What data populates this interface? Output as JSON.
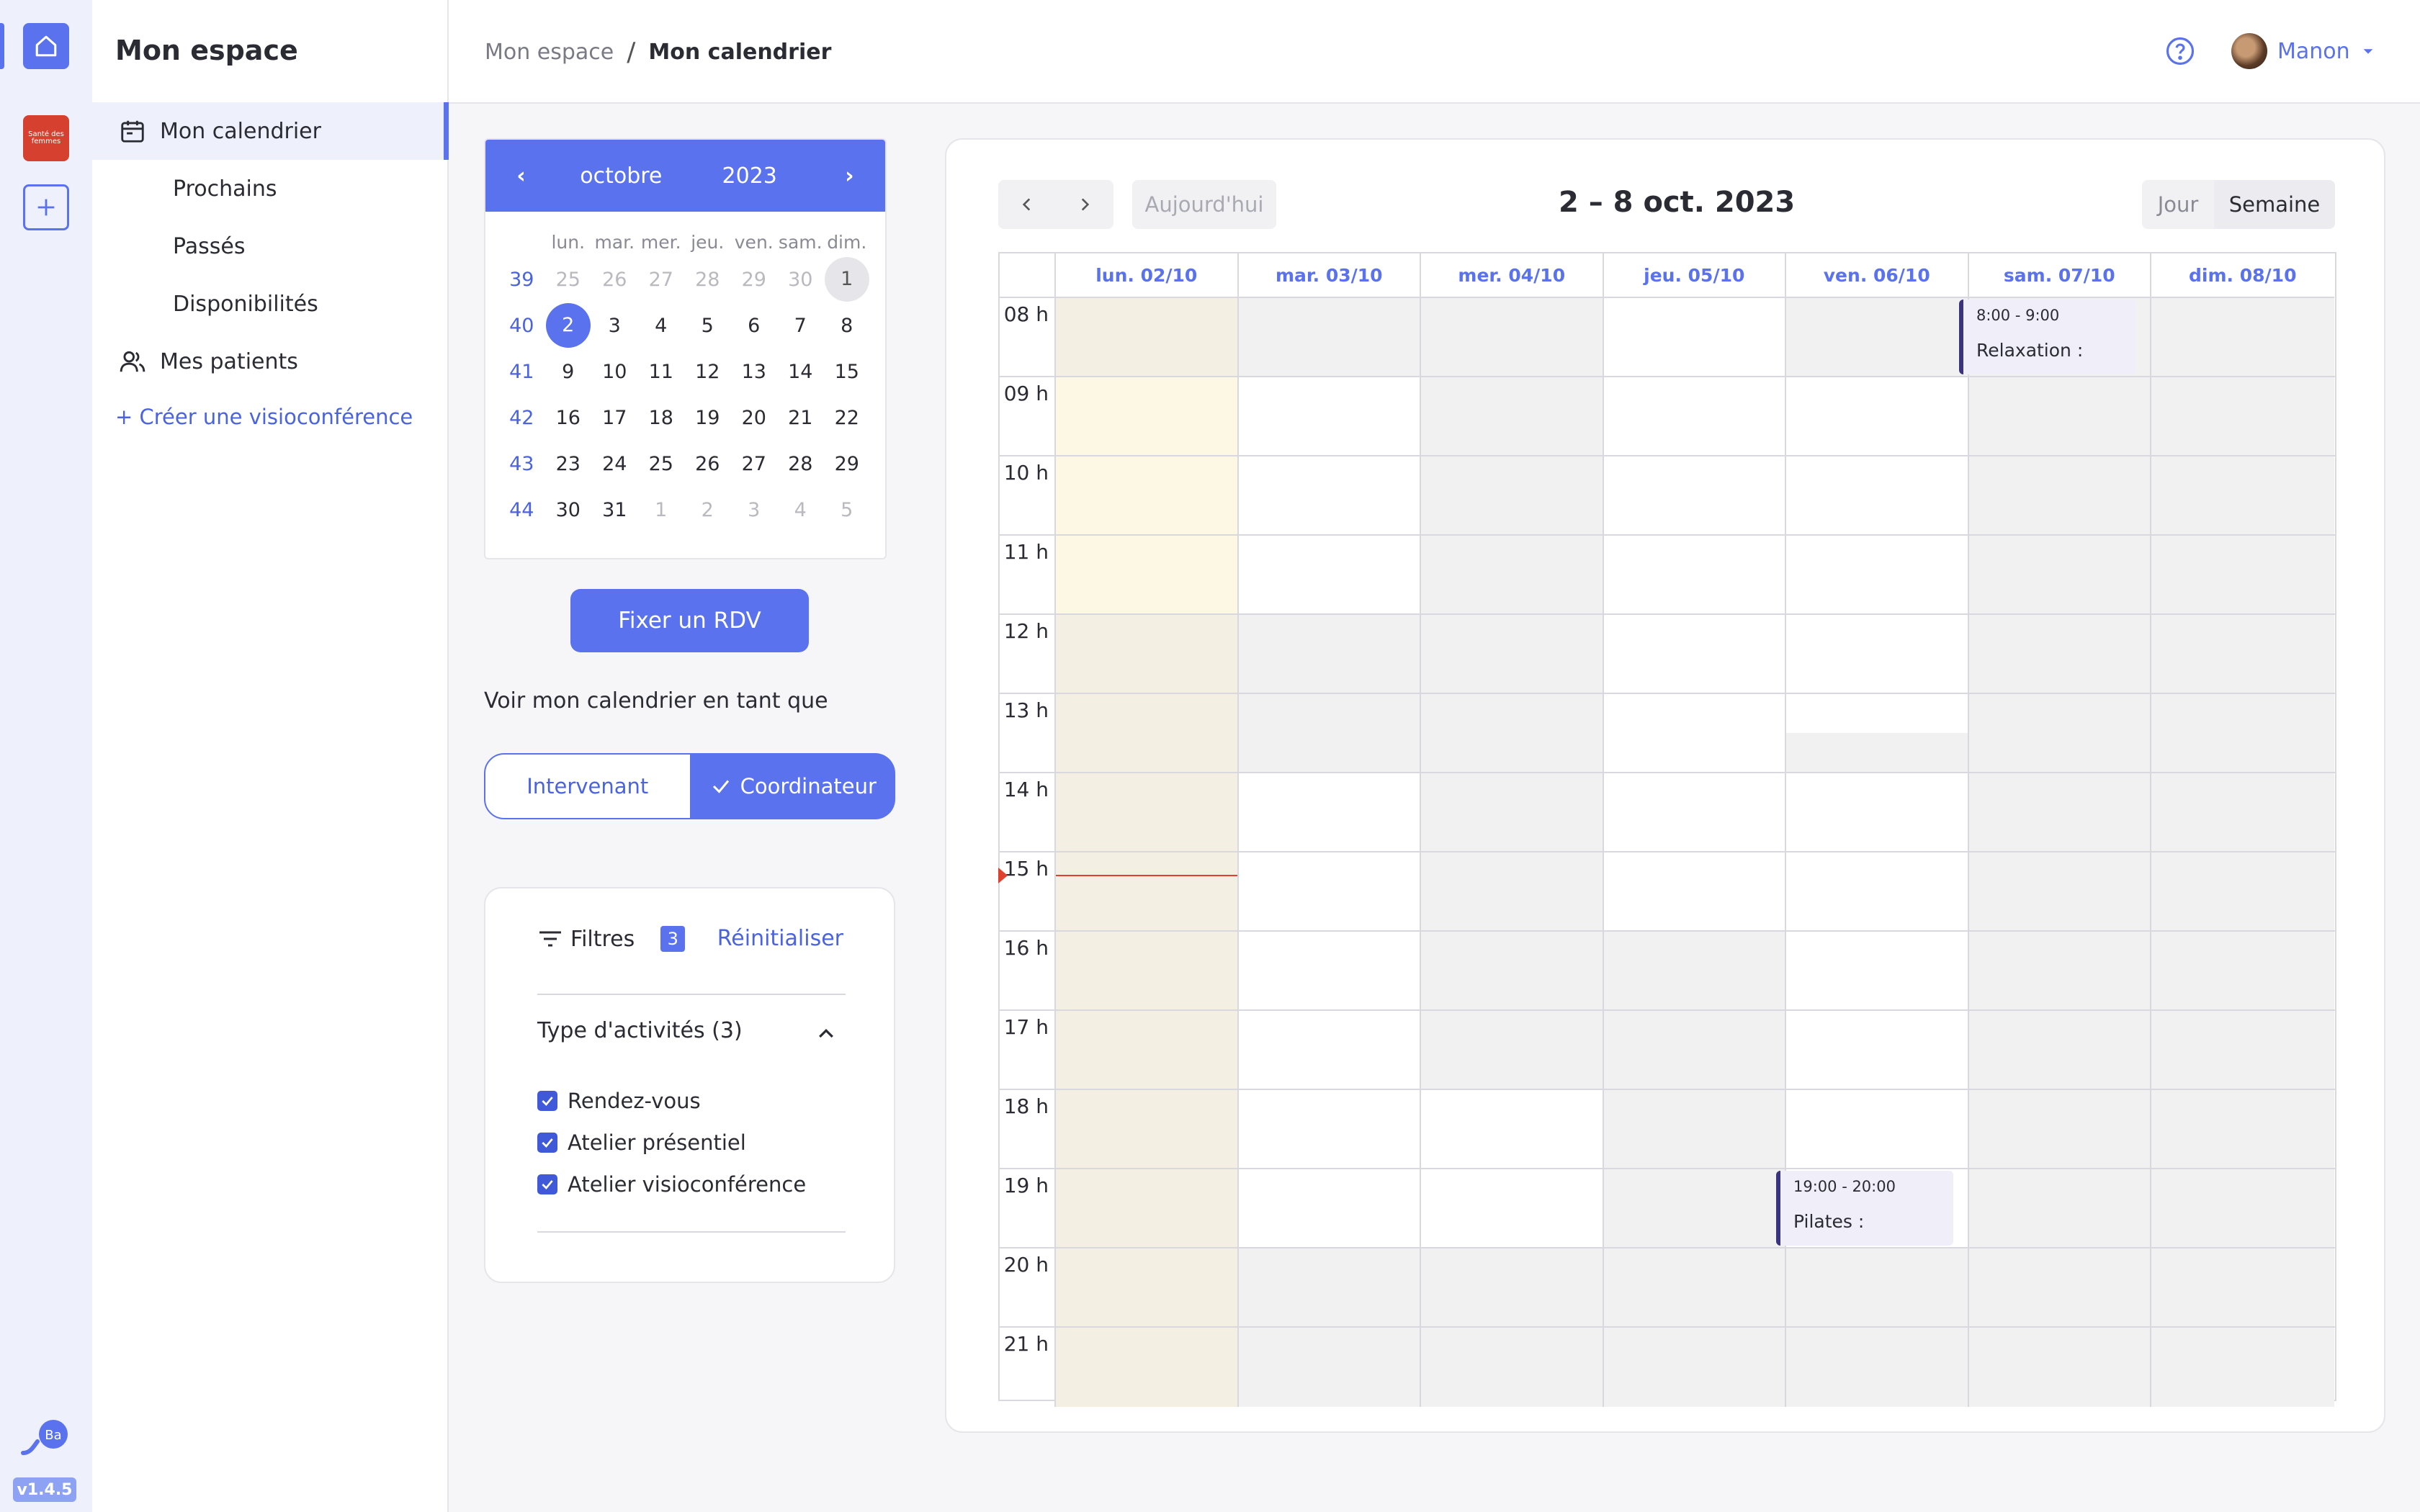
{
  "app": {
    "version": "v1.4.5",
    "brand_badge": "Santé des femmes"
  },
  "sidebar": {
    "title": "Mon espace",
    "items": [
      {
        "label": "Mon calendrier",
        "icon": "calendar-icon",
        "active": true
      },
      {
        "label": "Prochains"
      },
      {
        "label": "Passés"
      },
      {
        "label": "Disponibilités"
      },
      {
        "label": "Mes patients",
        "icon": "users-icon"
      }
    ],
    "create_link": "+ Créer une visioconférence"
  },
  "header": {
    "breadcrumb": [
      "Mon espace",
      "/",
      "Mon calendrier"
    ],
    "user_name": "Manon",
    "help_icon": "question-circle-icon"
  },
  "mini_calendar": {
    "prev": "‹",
    "next": "›",
    "month": "octobre",
    "year": "2023",
    "weekdays": [
      "lun.",
      "mar.",
      "mer.",
      "jeu.",
      "ven.",
      "sam.",
      "dim."
    ],
    "weeks": [
      {
        "num": "39",
        "days": [
          "25",
          "26",
          "27",
          "28",
          "29",
          "30",
          "1"
        ]
      },
      {
        "num": "40",
        "days": [
          "2",
          "3",
          "4",
          "5",
          "6",
          "7",
          "8"
        ]
      },
      {
        "num": "41",
        "days": [
          "9",
          "10",
          "11",
          "12",
          "13",
          "14",
          "15"
        ]
      },
      {
        "num": "42",
        "days": [
          "16",
          "17",
          "18",
          "19",
          "20",
          "21",
          "22"
        ]
      },
      {
        "num": "43",
        "days": [
          "23",
          "24",
          "25",
          "26",
          "27",
          "28",
          "29"
        ]
      },
      {
        "num": "44",
        "days": [
          "30",
          "31",
          "1",
          "2",
          "3",
          "4",
          "5"
        ]
      }
    ],
    "selected_day": "2",
    "highlighted_day": "1"
  },
  "actions": {
    "rdv_button": "Fixer un RDV",
    "see_as_label": "Voir mon calendrier en tant que",
    "role_options": [
      "Intervenant",
      "Coordinateur"
    ],
    "selected_role": "Coordinateur"
  },
  "filters": {
    "title": "Filtres",
    "count": "3",
    "reset": "Réinitialiser",
    "group_title": "Type d'activités (3)",
    "options": [
      {
        "label": "Rendez-vous",
        "checked": true
      },
      {
        "label": "Atelier présentiel",
        "checked": true
      },
      {
        "label": "Atelier visioconférence",
        "checked": true
      }
    ]
  },
  "calendar": {
    "today_button": "Aujourd'hui",
    "range_title": "2 – 8 oct. 2023",
    "views": [
      "Jour",
      "Semaine"
    ],
    "active_view": "Semaine",
    "days": [
      "lun. 02/10",
      "mar. 03/10",
      "mer. 04/10",
      "jeu. 05/10",
      "ven. 06/10",
      "sam. 07/10",
      "dim. 08/10"
    ],
    "hours": [
      "08 h",
      "09 h",
      "10 h",
      "11 h",
      "12 h",
      "13 h",
      "14 h",
      "15 h",
      "16 h",
      "17 h",
      "18 h",
      "19 h",
      "20 h",
      "21 h"
    ],
    "events": [
      {
        "day": 3,
        "start": "8:00",
        "time": "8:00 - 9:00",
        "title": "Relaxation :"
      },
      {
        "day": 2,
        "start": "19:00",
        "time": "19:00 - 20:00",
        "title": "Pilates :"
      }
    ],
    "current_time": "15:40",
    "colors": {
      "accent": "#5a72ee",
      "now": "#e0402e",
      "event_border": "#3a3380"
    }
  }
}
